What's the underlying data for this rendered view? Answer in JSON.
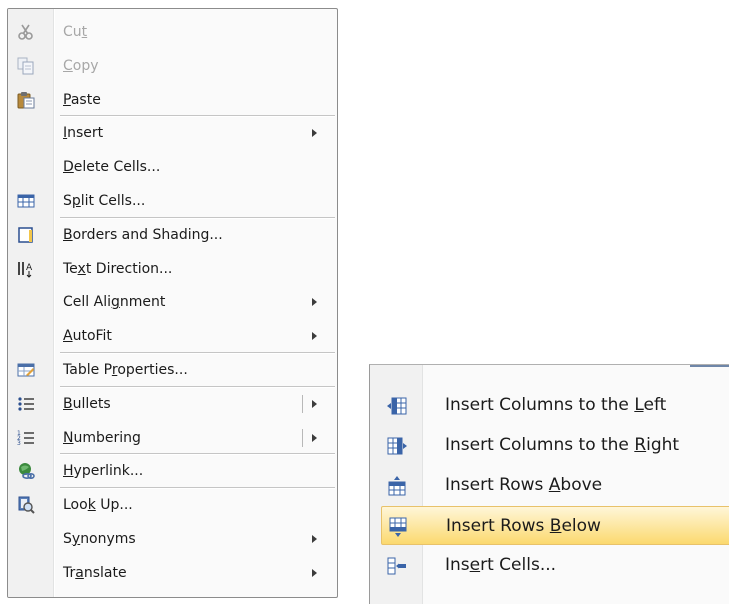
{
  "main_menu": {
    "items": [
      {
        "label_pre": "Cu",
        "label_key": "t",
        "label_post": "",
        "icon": "scissors-icon",
        "disabled": true
      },
      {
        "label_pre": "",
        "label_key": "C",
        "label_post": "opy",
        "icon": "copy-icon",
        "disabled": true
      },
      {
        "label_pre": "",
        "label_key": "P",
        "label_post": "aste",
        "icon": "paste-icon",
        "disabled": false
      },
      {
        "label_pre": "",
        "label_key": "I",
        "label_post": "nsert",
        "icon": "",
        "submenu": true
      },
      {
        "label_pre": "",
        "label_key": "D",
        "label_post": "elete Cells...",
        "icon": ""
      },
      {
        "label_pre": "S",
        "label_key": "p",
        "label_post": "lit Cells...",
        "icon": "split-cells-icon"
      },
      {
        "label_pre": "",
        "label_key": "B",
        "label_post": "orders and Shading...",
        "icon": "borders-icon"
      },
      {
        "label_pre": "Te",
        "label_key": "x",
        "label_post": "t Direction...",
        "icon": "text-direction-icon"
      },
      {
        "label_pre": "Cell Ali",
        "label_key": "g",
        "label_post": "nment",
        "icon": "",
        "submenu": true
      },
      {
        "label_pre": "",
        "label_key": "A",
        "label_post": "utoFit",
        "icon": "",
        "submenu": true
      },
      {
        "label_pre": "Table P",
        "label_key": "r",
        "label_post": "operties...",
        "icon": "table-properties-icon"
      },
      {
        "label_pre": "",
        "label_key": "B",
        "label_post": "ullets",
        "icon": "bullets-icon",
        "submenu": true,
        "split": true
      },
      {
        "label_pre": "",
        "label_key": "N",
        "label_post": "umbering",
        "icon": "numbering-icon",
        "submenu": true,
        "split": true
      },
      {
        "label_pre": "",
        "label_key": "H",
        "label_post": "yperlink...",
        "icon": "hyperlink-icon"
      },
      {
        "label_pre": "Loo",
        "label_key": "k",
        "label_post": " Up...",
        "icon": "look-up-icon"
      },
      {
        "label_pre": "S",
        "label_key": "y",
        "label_post": "nonyms",
        "icon": "",
        "submenu": true
      },
      {
        "label_pre": "Tr",
        "label_key": "a",
        "label_post": "nslate",
        "icon": "",
        "submenu": true
      }
    ]
  },
  "insert_submenu": {
    "items": [
      {
        "label_pre": "Insert Columns to the ",
        "label_key": "L",
        "label_post": "eft",
        "icon": "insert-columns-left-icon"
      },
      {
        "label_pre": "Insert Columns to the ",
        "label_key": "R",
        "label_post": "ight",
        "icon": "insert-columns-right-icon"
      },
      {
        "label_pre": "Insert Rows ",
        "label_key": "A",
        "label_post": "bove",
        "icon": "insert-rows-above-icon"
      },
      {
        "label_pre": "Insert Rows ",
        "label_key": "B",
        "label_post": "elow",
        "icon": "insert-rows-below-icon",
        "highlighted": true
      },
      {
        "label_pre": "Ins",
        "label_key": "e",
        "label_post": "rt Cells...",
        "icon": "insert-cells-icon"
      }
    ]
  },
  "colors": {
    "highlight_top": "#fff6d8",
    "highlight_bottom": "#fbd96f",
    "highlight_border": "#e8c26a",
    "gutter": "#f1f1f1",
    "menu_bg": "#fafafa"
  }
}
